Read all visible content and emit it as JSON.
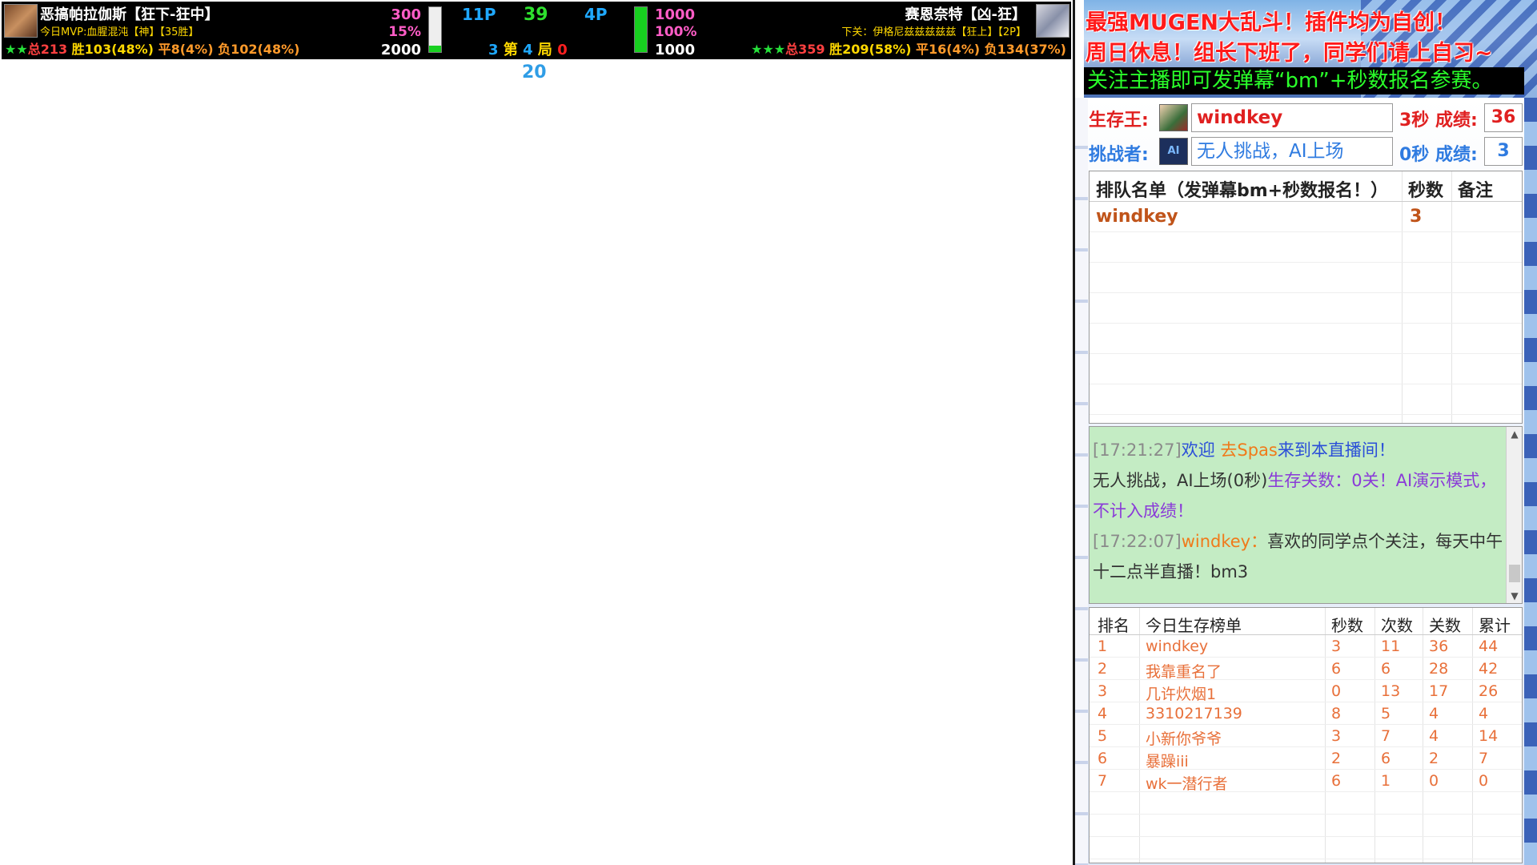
{
  "hud": {
    "p1": {
      "name": "恶搞帕拉伽斯【狂下-狂中】",
      "mvp": "今日MVP:血腥混沌【神】【35胜】",
      "stars": "★★",
      "total": "总213",
      "win": "胜103(48%)",
      "draw": "平8(4%)",
      "lose": "负102(48%)",
      "hp": "300",
      "pct": "15%",
      "power": "2000",
      "bar_fill": 0.15,
      "level": "11P"
    },
    "p2": {
      "name": "赛恩奈特【凶-狂】",
      "next": "下关：伊格尼兹兹兹兹兹【狂上】【2P】",
      "stars": "★★★",
      "total": "总359",
      "win": "胜209(58%)",
      "draw": "平16(4%)",
      "lose": "负134(37%)",
      "hp": "1000",
      "pct": "100%",
      "power": "1000",
      "bar_fill": 1.0,
      "level": "4P"
    },
    "timer": "39",
    "round": {
      "left": "3",
      "word1": "第",
      "num": "4",
      "word2": "局",
      "right": "0"
    },
    "seconds": "20"
  },
  "banner": {
    "line1": "最强MUGEN大乱斗！插件均为自创！",
    "line2": "周日休息！组长下班了，同学们请上自习~",
    "line3": "关注主播即可发弹幕“bm”+秒数报名参赛。"
  },
  "king": {
    "label": "生存王:",
    "name": "windkey",
    "seconds": "3秒",
    "score_label": "成绩:",
    "score": "36"
  },
  "challenger": {
    "label": "挑战者:",
    "avatar_text": "AI",
    "name": "无人挑战，AI上场",
    "seconds": "0秒",
    "score_label": "成绩:",
    "score": "3"
  },
  "queue": {
    "headers": [
      "排队名单（发弹幕bm+秒数报名！）",
      "秒数",
      "备注"
    ],
    "rows": [
      {
        "name": "windkey",
        "sec": "3",
        "note": ""
      }
    ]
  },
  "chat": {
    "messages": [
      {
        "time": "[17:21:27]",
        "p1": "欢迎 ",
        "user": "去Spas",
        "p2": "来到本直播间！"
      },
      {
        "a": "无人挑战，AI上场(0秒)",
        "b": "生存关数：0关！AI演示模式，不计入成绩！"
      },
      {
        "time": "[17:22:07]",
        "user": "windkey",
        "colon": "：",
        "text": "喜欢的同学点个关注，每天中午十二点半直播！bm3"
      }
    ]
  },
  "board": {
    "headers": [
      "排名",
      "今日生存榜单",
      "秒数",
      "次数",
      "关数",
      "累计"
    ],
    "rows": [
      [
        "1",
        "windkey",
        "3",
        "11",
        "36",
        "44"
      ],
      [
        "2",
        "我靠重名了",
        "6",
        "6",
        "28",
        "42"
      ],
      [
        "3",
        "几许炊烟1",
        "0",
        "13",
        "17",
        "26"
      ],
      [
        "4",
        "3310217139",
        "8",
        "5",
        "4",
        "4"
      ],
      [
        "5",
        "小新你爷爷",
        "3",
        "7",
        "4",
        "14"
      ],
      [
        "6",
        "暴躁iii",
        "2",
        "6",
        "2",
        "7"
      ],
      [
        "7",
        "wk一潜行者",
        "6",
        "1",
        "0",
        "0"
      ]
    ]
  }
}
